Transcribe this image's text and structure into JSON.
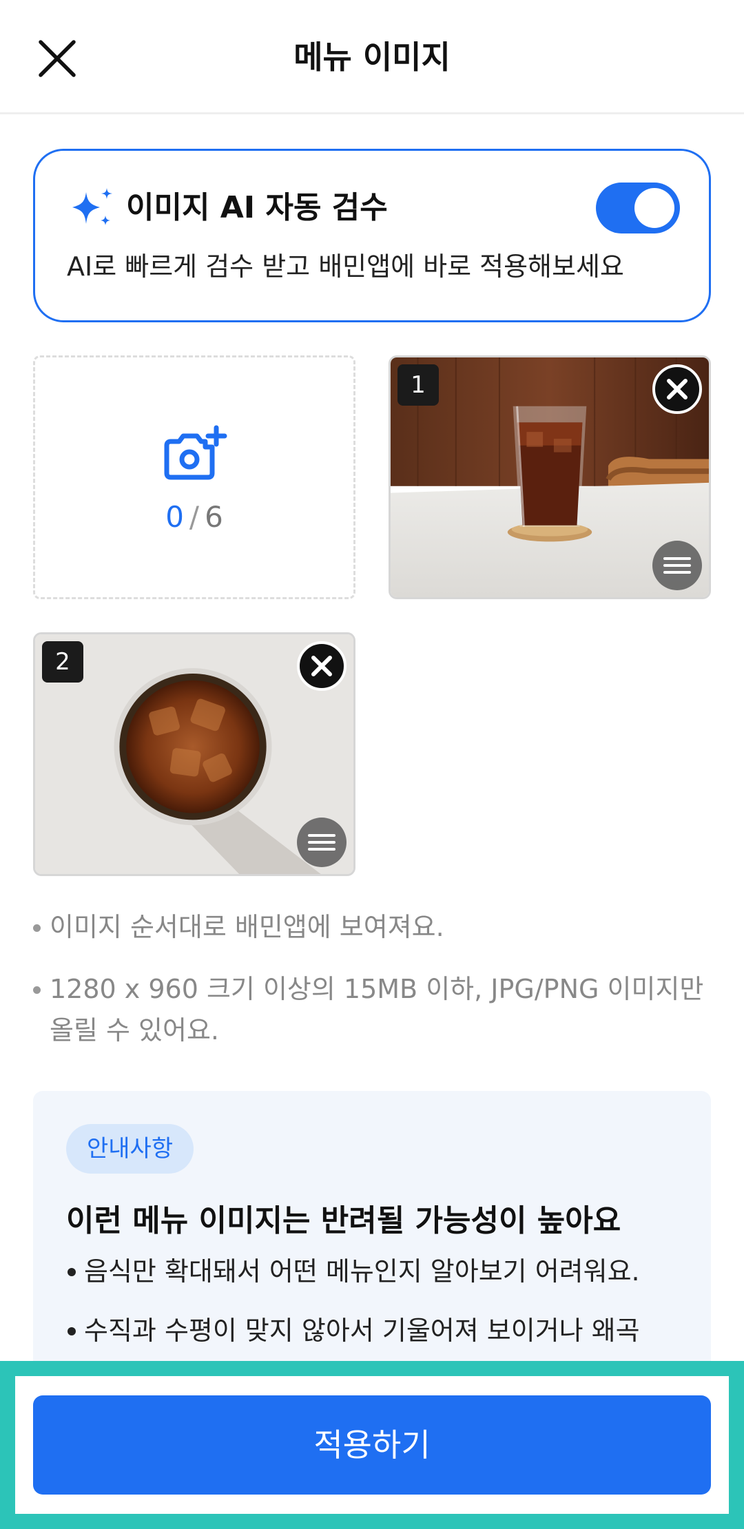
{
  "header": {
    "title": "메뉴 이미지",
    "close_icon": "close-icon"
  },
  "ai_review": {
    "title": "이미지 AI 자동 검수",
    "description": "AI로 빠르게 검수 받고 배민앱에 바로 적용해보세요",
    "enabled": true,
    "icon": "sparkle-icon",
    "accent_color": "#1f6ff2"
  },
  "upload": {
    "current": "0",
    "separator": "/",
    "max": "6",
    "icon": "camera-add-icon"
  },
  "photos": [
    {
      "index": "1",
      "description_icon": "iced-coffee-side-photo"
    },
    {
      "index": "2",
      "description_icon": "iced-coffee-top-photo"
    }
  ],
  "notes": [
    "이미지 순서대로 배민앱에 보여져요.",
    "1280 x 960 크기 이상의 15MB 이하, JPG/PNG 이미지만 올릴 수 있어요."
  ],
  "info": {
    "badge": "안내사항",
    "title": "이런 메뉴 이미지는 반려될 가능성이 높아요",
    "items": [
      "음식만 확대돼서 어떤 메뉴인지 알아보기 어려워요.",
      "수직과 수평이 맞지 않아서 기울어져 보이거나 왜곡"
    ]
  },
  "footer": {
    "apply_label": "적용하기",
    "highlight_color": "#2cc4b8"
  }
}
